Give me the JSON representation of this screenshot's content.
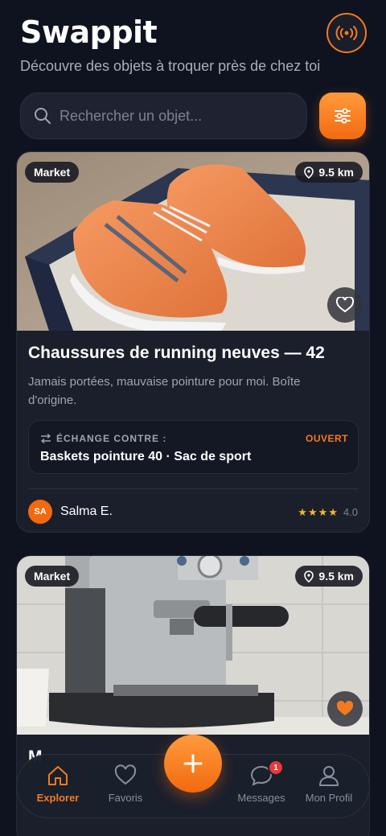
{
  "header": {
    "title": "Swappit",
    "subtitle": "Découvre des objets à troquer près de chez toi"
  },
  "search": {
    "placeholder": "Rechercher un objet..."
  },
  "listings": [
    {
      "badge": "Market",
      "distance": "9.5 km",
      "favorited": false,
      "title": "Chaussures de running neuves — 42",
      "description": "Jamais portées, mauvaise pointure pour moi. Boîte d'origine.",
      "exchange_label": "ÉCHANGE CONTRE :",
      "exchange_status": "OUVERT",
      "exchange_items": "Baskets pointure 40 · Sac de sport",
      "owner_initials": "SA",
      "owner_name": "Salma E.",
      "stars": "★★★★",
      "rating": "4.0"
    },
    {
      "badge": "Market",
      "distance": "9.5 km",
      "favorited": true,
      "title_partial": "M"
    }
  ],
  "nav": {
    "items": [
      {
        "label": "Explorer",
        "icon": "home-icon",
        "active": true
      },
      {
        "label": "Favoris",
        "icon": "heart-icon",
        "active": false
      },
      {
        "label": "Messages",
        "icon": "chat-icon",
        "active": false,
        "badge": "1"
      },
      {
        "label": "Mon Profil",
        "icon": "user-icon",
        "active": false
      }
    ],
    "fab_icon": "plus-icon"
  },
  "colors": {
    "accent": "#f47a1f",
    "background": "#0f1320",
    "card": "#1b1f2c"
  }
}
